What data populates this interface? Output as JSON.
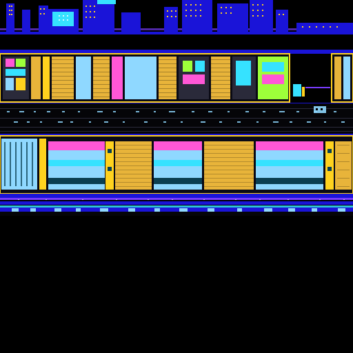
{
  "image": {
    "description_visible_text": "",
    "palette": {
      "background": "#000000",
      "deep_blue": "#1a14d8",
      "violet": "#7a3cff",
      "gold": "#e8b43a",
      "yellow": "#ffd21e",
      "cyan": "#36e2ff",
      "sky": "#8fd8ff",
      "magenta": "#ff57d6",
      "lime": "#9dff3a",
      "white": "#ffffff",
      "dark_teal": "#0a3f52",
      "gray": "#2a2a3a"
    },
    "regions": [
      {
        "name": "skyline",
        "rows_fraction": [
          0.0,
          0.1
        ]
      },
      {
        "name": "upper-block-band",
        "rows_fraction": [
          0.14,
          0.29
        ]
      },
      {
        "name": "dark-wiring-band",
        "rows_fraction": [
          0.29,
          0.38
        ]
      },
      {
        "name": "lower-block-band",
        "rows_fraction": [
          0.38,
          0.55
        ]
      },
      {
        "name": "bottom-stripes",
        "rows_fraction": [
          0.55,
          0.62
        ]
      },
      {
        "name": "empty-black",
        "rows_fraction": [
          0.62,
          1.0
        ]
      }
    ]
  }
}
